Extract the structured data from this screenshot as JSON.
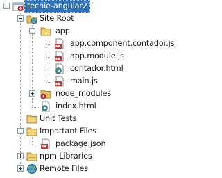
{
  "tree": {
    "project": "techie-angular2",
    "site_root": "Site Root",
    "app_folder": "app",
    "app_files": [
      "app.component.contador.js",
      "app.module.js",
      "contador.html",
      "main.js"
    ],
    "node_modules": "node_modules",
    "index_file": "index.html",
    "unit_tests": "Unit Tests",
    "important_files": "Important Files",
    "package_json": "package.json",
    "npm_libraries": "npm Libraries",
    "remote_files": "Remote Files"
  },
  "colors": {
    "selection": "#2d71b8",
    "folder": "#e8c060",
    "js_badge": "#c73a3a",
    "html_badge": "#3f8f8f"
  },
  "icons": {
    "project": "project-icon",
    "site_root": "globe-folder-icon",
    "folder": "folder-icon",
    "js_file": "javascript-file-icon",
    "html_file": "html-file-icon",
    "node_modules": "error-folder-icon",
    "unit_tests": "folder-icon",
    "important_files": "folder-icon",
    "package_json": "json-file-icon",
    "npm_libraries": "npm-folder-icon",
    "remote_files": "globe-icon"
  }
}
